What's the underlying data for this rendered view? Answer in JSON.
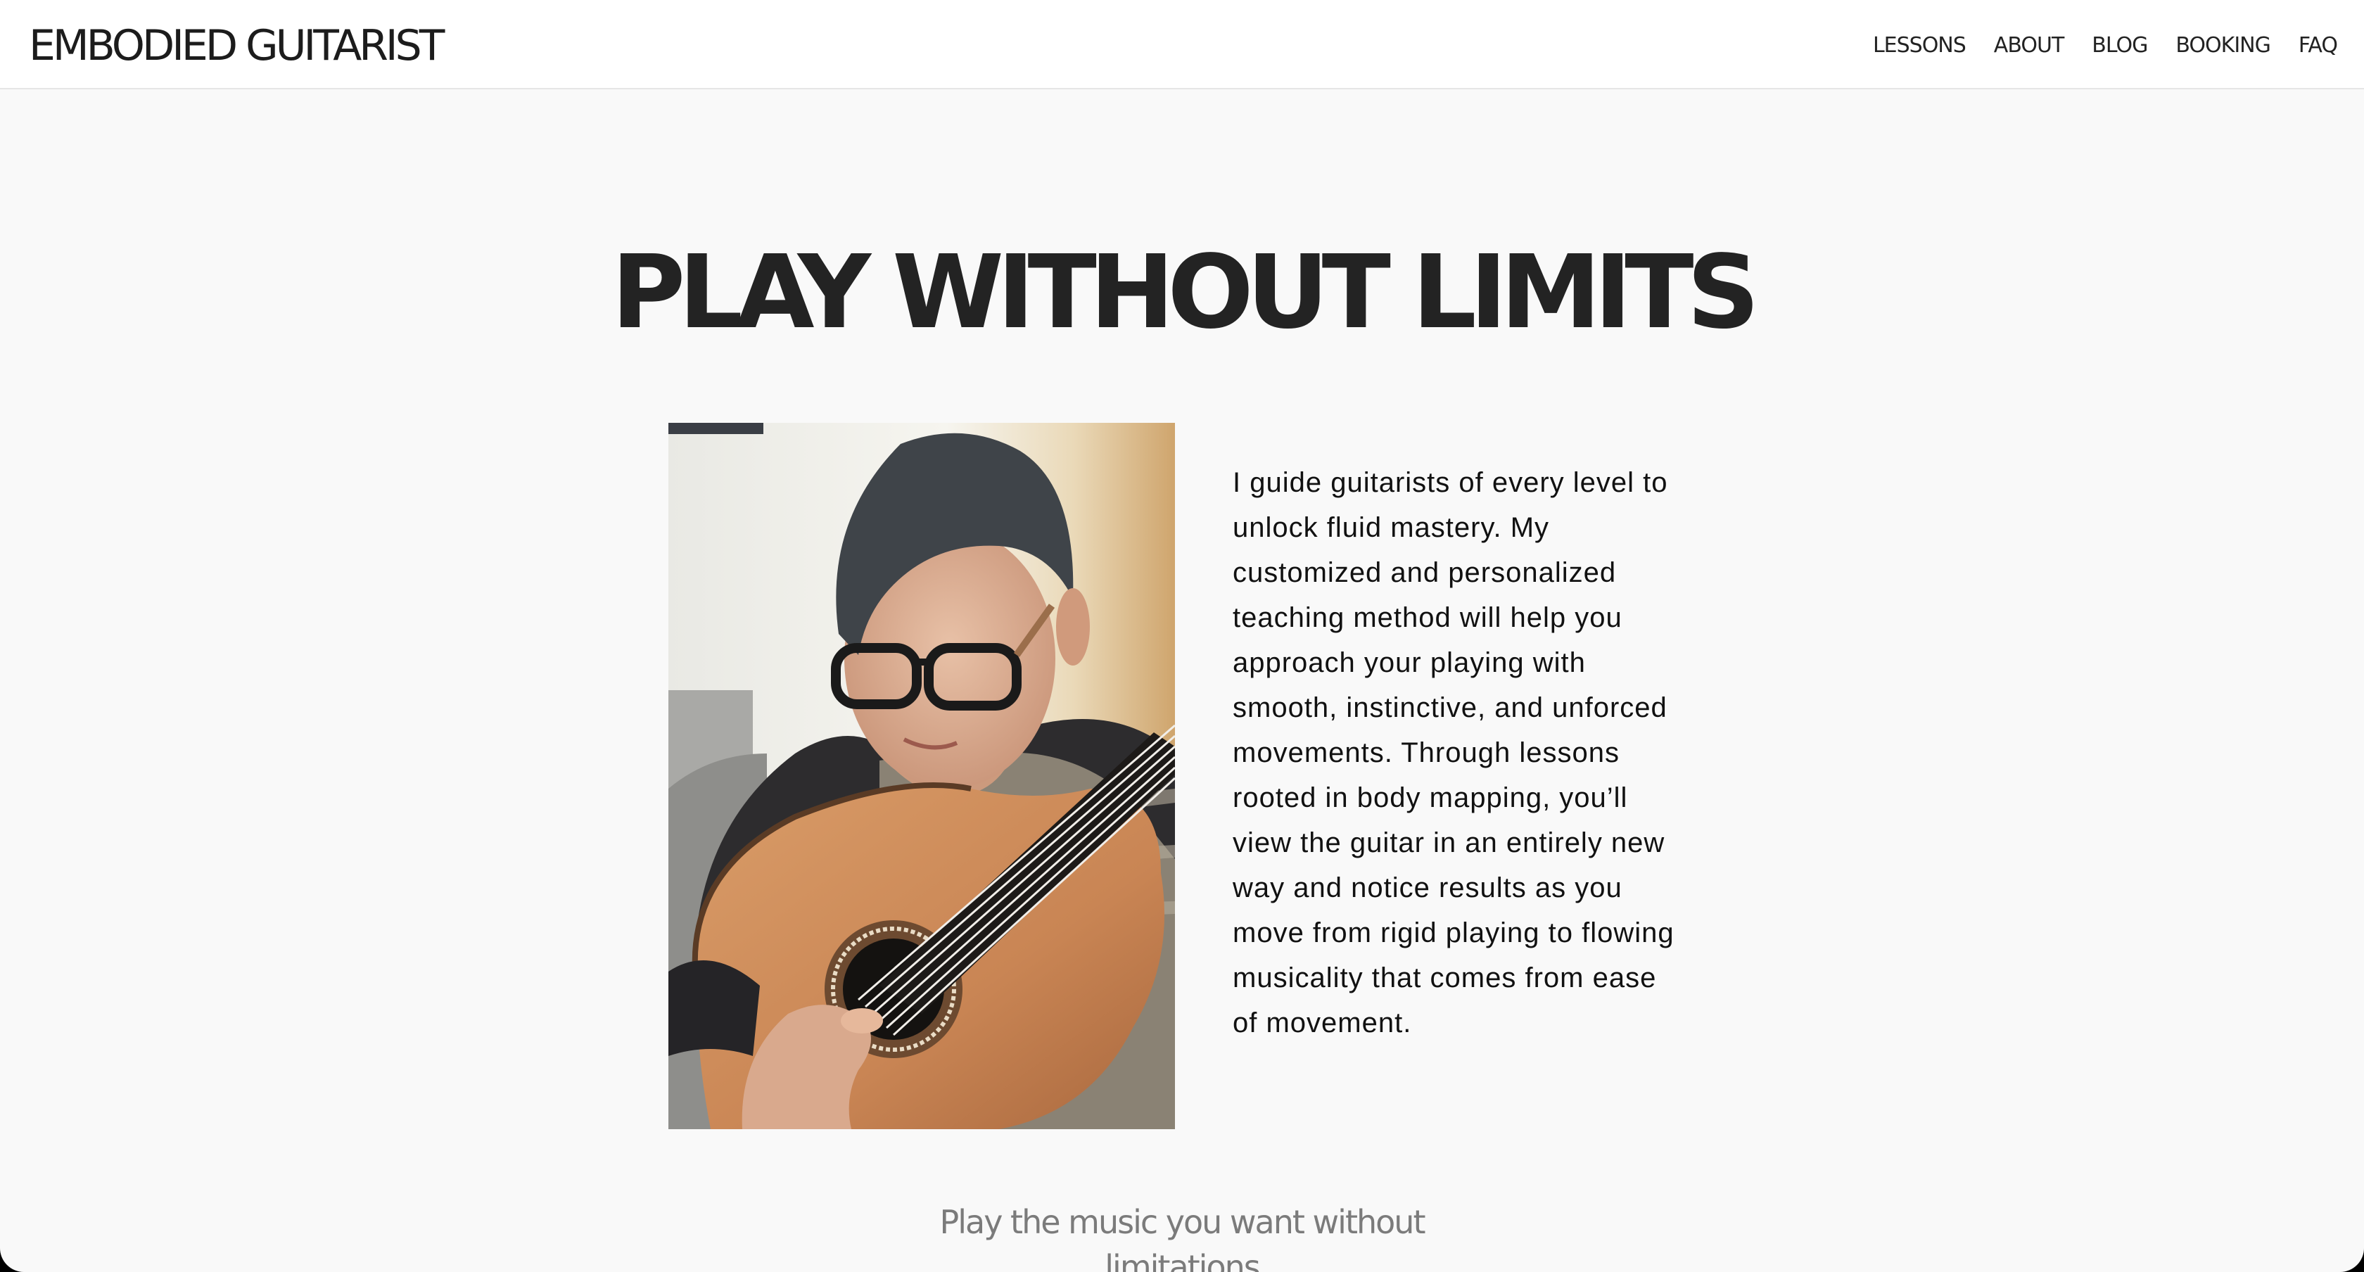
{
  "header": {
    "logo": "EMBODIED GUITARIST",
    "nav": [
      "LESSONS",
      "ABOUT",
      "BLOG",
      "BOOKING",
      "FAQ"
    ]
  },
  "hero": {
    "title": "PLAY WITHOUT LIMITS",
    "intro": "I guide guitarists of every level to unlock fluid mastery. My customized and personalized teaching method will help you approach your playing with smooth, instinctive, and unforced movements. Through lessons rooted in body mapping, you’ll view the guitar in an entirely new way and notice results as you move from rigid playing to flowing musicality that comes from ease of movement."
  },
  "tagline": {
    "line1": "Play the music you want without",
    "line2": "limitations"
  },
  "colors": {
    "page_background": "#f9f9f9",
    "header_background": "#ffffff",
    "title_text": "#232323",
    "tagline_text": "#7b7b7b"
  }
}
